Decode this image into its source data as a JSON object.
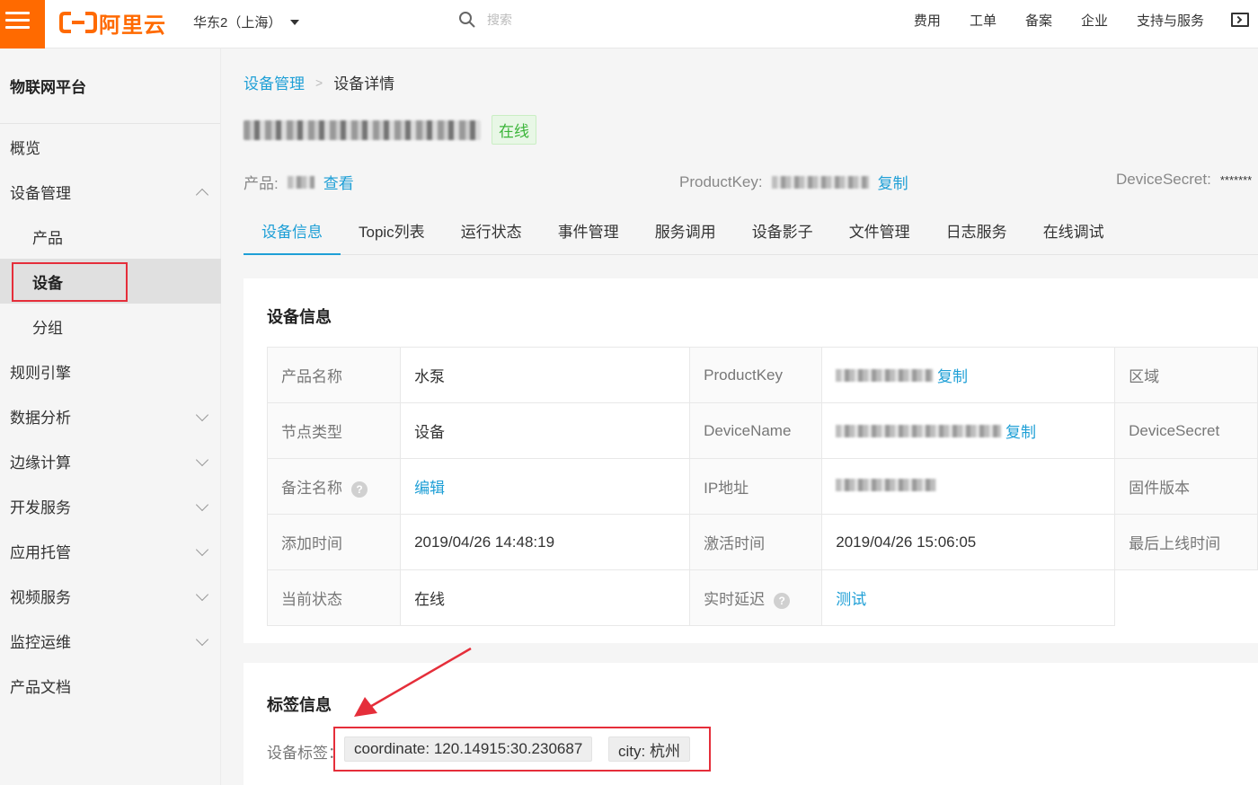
{
  "topbar": {
    "logo_text": "阿里云",
    "region": "华东2（上海）",
    "search_placeholder": "搜索",
    "nav": [
      "费用",
      "工单",
      "备案",
      "企业",
      "支持与服务"
    ]
  },
  "sidebar": {
    "title": "物联网平台",
    "items": [
      {
        "label": "概览"
      },
      {
        "label": "设备管理"
      },
      {
        "label": "产品"
      },
      {
        "label": "设备"
      },
      {
        "label": "分组"
      },
      {
        "label": "规则引擎"
      },
      {
        "label": "数据分析"
      },
      {
        "label": "边缘计算"
      },
      {
        "label": "开发服务"
      },
      {
        "label": "应用托管"
      },
      {
        "label": "视频服务"
      },
      {
        "label": "监控运维"
      },
      {
        "label": "产品文档"
      }
    ]
  },
  "breadcrumb": {
    "parent": "设备管理",
    "current": "设备详情"
  },
  "device": {
    "status": "在线",
    "product_label": "产品:",
    "view_link": "查看",
    "productkey_label": "ProductKey:",
    "copy_link": "复制",
    "devicesecret_label": "DeviceSecret:",
    "devicesecret_value": "*******"
  },
  "tabs": [
    "设备信息",
    "Topic列表",
    "运行状态",
    "事件管理",
    "服务调用",
    "设备影子",
    "文件管理",
    "日志服务",
    "在线调试"
  ],
  "info_card": {
    "title": "设备信息",
    "rows": [
      {
        "l1": "产品名称",
        "v1": "水泵",
        "l2": "ProductKey",
        "v2_link": "复制",
        "l3": "区域"
      },
      {
        "l1": "节点类型",
        "v1": "设备",
        "l2": "DeviceName",
        "v2_link": "复制",
        "l3": "DeviceSecret"
      },
      {
        "l1": "备注名称",
        "v1_link": "编辑",
        "l2": "IP地址",
        "l3": "固件版本"
      },
      {
        "l1": "添加时间",
        "v1": "2019/04/26 14:48:19",
        "l2": "激活时间",
        "v2": "2019/04/26 15:06:05",
        "l3": "最后上线时间"
      },
      {
        "l1": "当前状态",
        "v1": "在线",
        "l2": "实时延迟",
        "v2_link": "测试"
      }
    ]
  },
  "tag_card": {
    "title": "标签信息",
    "label": "设备标签：",
    "tags": [
      "coordinate: 120.14915:30.230687",
      "city: 杭州"
    ]
  },
  "colors": {
    "brand": "#ff6a00",
    "link": "#1e9fd6",
    "online": "#3cb53a",
    "highlight": "#e52e3a"
  }
}
